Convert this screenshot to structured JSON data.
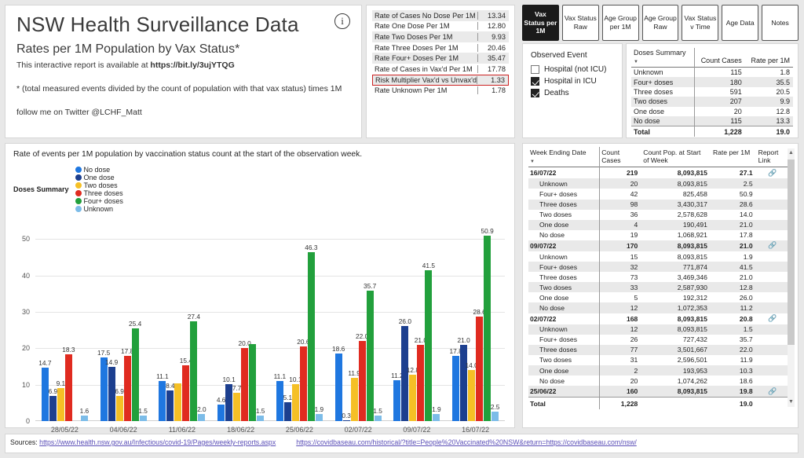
{
  "title": {
    "main": "NSW Health Surveillance Data",
    "sub": "Rates per 1M Population by Vax Status*",
    "available_prefix": "This interactive report is available at ",
    "available_link": "https://bit.ly/3ujYTQG",
    "footnote": "* (total measured events divided by the count of population with that vax status) times 1M",
    "twitter": "follow me on Twitter @LCHF_Matt",
    "info_icon": "info-icon"
  },
  "rates": [
    {
      "label": "Rate of Cases No Dose Per 1M",
      "value": "13.34",
      "highlight": false
    },
    {
      "label": "Rate One Dose Per 1M",
      "value": "12.80",
      "highlight": false
    },
    {
      "label": "Rate Two Doses Per 1M",
      "value": "9.93",
      "highlight": false
    },
    {
      "label": "Rate Three Doses Per 1M",
      "value": "20.46",
      "highlight": false
    },
    {
      "label": "Rate Four+ Doses Per 1M",
      "value": "35.47",
      "highlight": false
    },
    {
      "label": "Rate of Cases in Vax'd Per 1M",
      "value": "17.78",
      "highlight": false
    },
    {
      "label": "Risk Multiplier Vax'd vs Unvax'd",
      "value": "1.33",
      "highlight": true
    },
    {
      "label": "Rate Unknown Per 1M",
      "value": "1.78",
      "highlight": false
    }
  ],
  "tabs": [
    {
      "label": "Vax Status per 1M",
      "active": true
    },
    {
      "label": "Vax Status Raw",
      "active": false
    },
    {
      "label": "Age Group per 1M",
      "active": false
    },
    {
      "label": "Age Group Raw",
      "active": false
    },
    {
      "label": "Vax Status v Time",
      "active": false
    },
    {
      "label": "Age Data",
      "active": false
    },
    {
      "label": "Notes",
      "active": false
    }
  ],
  "observed_event": {
    "title": "Observed Event",
    "options": [
      {
        "label": "Hospital (not ICU)",
        "checked": false
      },
      {
        "label": "Hospital in ICU",
        "checked": true
      },
      {
        "label": "Deaths",
        "checked": true
      }
    ]
  },
  "doses_summary": {
    "headers": [
      "Doses Summary",
      "Count Cases",
      "Rate per 1M"
    ],
    "rows": [
      {
        "label": "Unknown",
        "count": "115",
        "rate": "1.8"
      },
      {
        "label": "Four+ doses",
        "count": "180",
        "rate": "35.5"
      },
      {
        "label": "Three doses",
        "count": "591",
        "rate": "20.5"
      },
      {
        "label": "Two doses",
        "count": "207",
        "rate": "9.9"
      },
      {
        "label": "One dose",
        "count": "20",
        "rate": "12.8"
      },
      {
        "label": "No dose",
        "count": "115",
        "rate": "13.3"
      }
    ],
    "total": {
      "label": "Total",
      "count": "1,228",
      "rate": "19.0"
    }
  },
  "chart_data": {
    "type": "bar",
    "title": "Rate of events per 1M population by vaccination status count at the start of the observation week.",
    "legend_title": "Doses Summary",
    "legend_position": "top",
    "xlabel": "",
    "ylabel": "",
    "ylim": [
      0,
      50
    ],
    "yticks": [
      0,
      10,
      20,
      30,
      40,
      50
    ],
    "grid": true,
    "categories": [
      "28/05/22",
      "04/06/22",
      "11/06/22",
      "18/06/22",
      "25/06/22",
      "02/07/22",
      "09/07/22",
      "16/07/22"
    ],
    "series": [
      {
        "name": "No dose",
        "color": "#1f77e0",
        "values": [
          14.7,
          17.5,
          11.1,
          4.6,
          11.1,
          18.6,
          11.2,
          17.8
        ]
      },
      {
        "name": "One dose",
        "color": "#1c3f8f",
        "values": [
          6.9,
          14.9,
          8.4,
          10.1,
          5.1,
          0.3,
          26.0,
          21.0
        ]
      },
      {
        "name": "Two doses",
        "color": "#f5c026",
        "values": [
          9.1,
          6.9,
          10.4,
          7.7,
          10.1,
          11.9,
          12.8,
          14.0
        ]
      },
      {
        "name": "Three doses",
        "color": "#e02b20",
        "values": [
          18.3,
          17.8,
          15.4,
          20.0,
          20.6,
          22.0,
          21.0,
          28.6
        ]
      },
      {
        "name": "Four+ doses",
        "color": "#22a03c",
        "values": [
          0,
          25.4,
          27.4,
          21.2,
          46.3,
          35.7,
          41.5,
          50.9
        ]
      },
      {
        "name": "Unknown",
        "color": "#7cbce8",
        "values": [
          1.6,
          1.5,
          2.0,
          1.5,
          1.9,
          1.5,
          1.9,
          2.5
        ]
      }
    ],
    "labels": {
      "28/05/22": [
        "14.7",
        "6.9",
        "9.1",
        "18.3",
        "",
        "1.6"
      ],
      "04/06/22": [
        "17.5",
        "14.9",
        "6.9",
        "17.8",
        "25.4",
        "1.5"
      ],
      "11/06/22": [
        "11.1",
        "8.4",
        "",
        "15.4",
        "27.4",
        "2.0"
      ],
      "18/06/22": [
        "4.6",
        "10.1",
        "7.7",
        "20.0",
        "",
        "1.5"
      ],
      "25/06/22": [
        "11.1",
        "5.1",
        "10.1",
        "20.6",
        "46.3",
        "1.9"
      ],
      "02/07/22": [
        "18.6",
        "0.3",
        "11.9",
        "22.0",
        "35.7",
        "1.5"
      ],
      "09/07/22": [
        "11.2",
        "26.0",
        "12.8",
        "21.0",
        "41.5",
        "1.9"
      ],
      "16/07/22": [
        "17.8",
        "21.0",
        "14.0",
        "28.6",
        "50.9",
        "2.5"
      ]
    }
  },
  "data_table": {
    "headers": [
      "Week Ending Date",
      "Count Cases",
      "Count Pop. at Start of Week",
      "Rate per 1M",
      "Report Link"
    ],
    "rows": [
      {
        "date": "16/07/22",
        "cases": "219",
        "pop": "8,093,815",
        "rate": "27.1",
        "link": true,
        "group": true,
        "shade": false
      },
      {
        "date": "Unknown",
        "cases": "20",
        "pop": "8,093,815",
        "rate": "2.5",
        "link": false,
        "group": false,
        "shade": true
      },
      {
        "date": "Four+ doses",
        "cases": "42",
        "pop": "825,458",
        "rate": "50.9",
        "link": false,
        "group": false,
        "shade": false
      },
      {
        "date": "Three doses",
        "cases": "98",
        "pop": "3,430,317",
        "rate": "28.6",
        "link": false,
        "group": false,
        "shade": true
      },
      {
        "date": "Two doses",
        "cases": "36",
        "pop": "2,578,628",
        "rate": "14.0",
        "link": false,
        "group": false,
        "shade": false
      },
      {
        "date": "One dose",
        "cases": "4",
        "pop": "190,491",
        "rate": "21.0",
        "link": false,
        "group": false,
        "shade": true
      },
      {
        "date": "No dose",
        "cases": "19",
        "pop": "1,068,921",
        "rate": "17.8",
        "link": false,
        "group": false,
        "shade": false
      },
      {
        "date": "09/07/22",
        "cases": "170",
        "pop": "8,093,815",
        "rate": "21.0",
        "link": true,
        "group": true,
        "shade": true
      },
      {
        "date": "Unknown",
        "cases": "15",
        "pop": "8,093,815",
        "rate": "1.9",
        "link": false,
        "group": false,
        "shade": false
      },
      {
        "date": "Four+ doses",
        "cases": "32",
        "pop": "771,874",
        "rate": "41.5",
        "link": false,
        "group": false,
        "shade": true
      },
      {
        "date": "Three doses",
        "cases": "73",
        "pop": "3,469,346",
        "rate": "21.0",
        "link": false,
        "group": false,
        "shade": false
      },
      {
        "date": "Two doses",
        "cases": "33",
        "pop": "2,587,930",
        "rate": "12.8",
        "link": false,
        "group": false,
        "shade": true
      },
      {
        "date": "One dose",
        "cases": "5",
        "pop": "192,312",
        "rate": "26.0",
        "link": false,
        "group": false,
        "shade": false
      },
      {
        "date": "No dose",
        "cases": "12",
        "pop": "1,072,353",
        "rate": "11.2",
        "link": false,
        "group": false,
        "shade": true
      },
      {
        "date": "02/07/22",
        "cases": "168",
        "pop": "8,093,815",
        "rate": "20.8",
        "link": true,
        "group": true,
        "shade": false
      },
      {
        "date": "Unknown",
        "cases": "12",
        "pop": "8,093,815",
        "rate": "1.5",
        "link": false,
        "group": false,
        "shade": true
      },
      {
        "date": "Four+ doses",
        "cases": "26",
        "pop": "727,432",
        "rate": "35.7",
        "link": false,
        "group": false,
        "shade": false
      },
      {
        "date": "Three doses",
        "cases": "77",
        "pop": "3,501,667",
        "rate": "22.0",
        "link": false,
        "group": false,
        "shade": true
      },
      {
        "date": "Two doses",
        "cases": "31",
        "pop": "2,596,501",
        "rate": "11.9",
        "link": false,
        "group": false,
        "shade": false
      },
      {
        "date": "One dose",
        "cases": "2",
        "pop": "193,953",
        "rate": "10.3",
        "link": false,
        "group": false,
        "shade": true
      },
      {
        "date": "No dose",
        "cases": "20",
        "pop": "1,074,262",
        "rate": "18.6",
        "link": false,
        "group": false,
        "shade": false
      },
      {
        "date": "25/06/22",
        "cases": "160",
        "pop": "8,093,815",
        "rate": "19.8",
        "link": true,
        "group": true,
        "shade": true
      }
    ],
    "total": {
      "label": "Total",
      "cases": "1,228",
      "pop": "",
      "rate": "19.0"
    }
  },
  "sources": {
    "label": "Sources:",
    "links": [
      "https://www.health.nsw.gov.au/Infectious/covid-19/Pages/weekly-reports.aspx",
      "https://covidbaseau.com/historical/?title=People%20Vaccinated%20NSW&return=https://covidbaseau.com/nsw/"
    ]
  }
}
